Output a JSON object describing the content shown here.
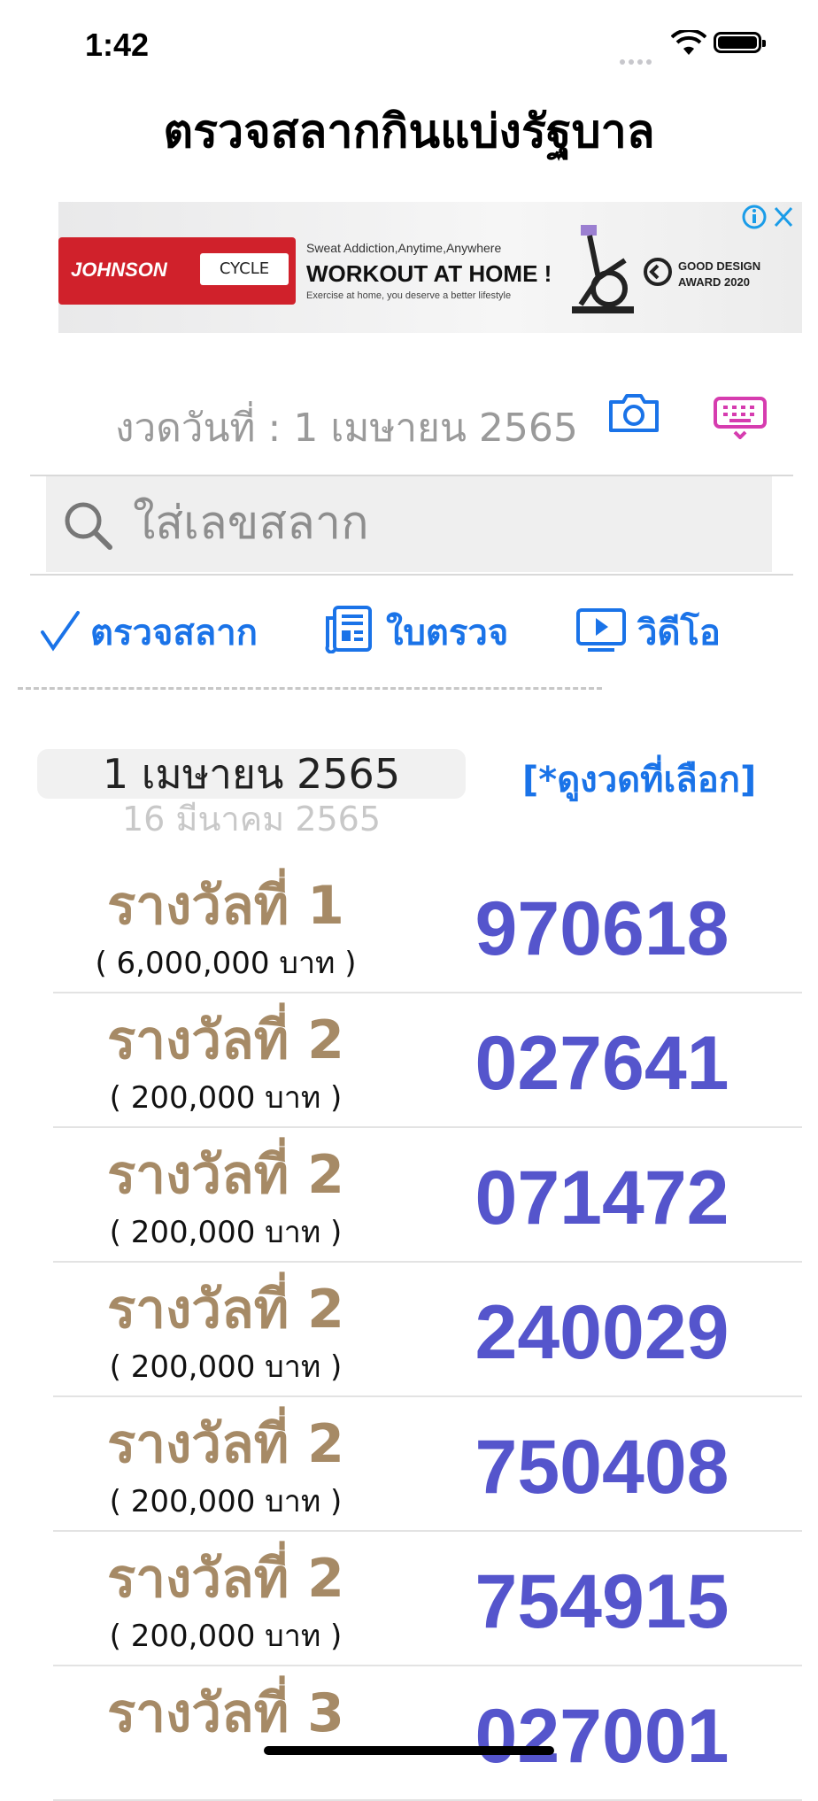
{
  "status_bar": {
    "time": "1:42"
  },
  "nav": {
    "title": "ตรวจสลากกินแบ่งรัฐบาล"
  },
  "ad": {
    "brand": "JOHNSON",
    "brand_badge": "CYCLE",
    "tagline": "Sweat Addiction,Anytime,Anywhere",
    "headline": "WORKOUT AT HOME !",
    "sub": "Exercise at home, you deserve a better lifestyle",
    "award_line1": "GOOD DESIGN",
    "award_line2": "AWARD 2020"
  },
  "draw": {
    "label": "งวดวันที่ :  1 เมษายน 2565"
  },
  "search": {
    "placeholder": "ใส่เลขสลาก",
    "value": ""
  },
  "tabs": {
    "check": "ตรวจสลาก",
    "sheet": "ใบตรวจ",
    "video": "วิดีโอ"
  },
  "picker": {
    "selected": "1 เมษายน 2565",
    "next": "16 มีนาคม 2565",
    "view_button": "[*ดูงวดที่เลือก]"
  },
  "prizes": [
    {
      "name": "รางวัลที่ 1",
      "amount": "( 6,000,000 บาท )",
      "number": "970618"
    },
    {
      "name": "รางวัลที่ 2",
      "amount": "( 200,000 บาท )",
      "number": "027641"
    },
    {
      "name": "รางวัลที่ 2",
      "amount": "( 200,000 บาท )",
      "number": "071472"
    },
    {
      "name": "รางวัลที่ 2",
      "amount": "( 200,000 บาท )",
      "number": "240029"
    },
    {
      "name": "รางวัลที่ 2",
      "amount": "( 200,000 บาท )",
      "number": "750408"
    },
    {
      "name": "รางวัลที่ 2",
      "amount": "( 200,000 บาท )",
      "number": "754915"
    },
    {
      "name": "รางวัลที่ 3",
      "amount": "",
      "number": "027001"
    }
  ],
  "colors": {
    "accent": "#1a73e8",
    "prize_name": "#a68a66",
    "prize_number": "#5555cc"
  }
}
